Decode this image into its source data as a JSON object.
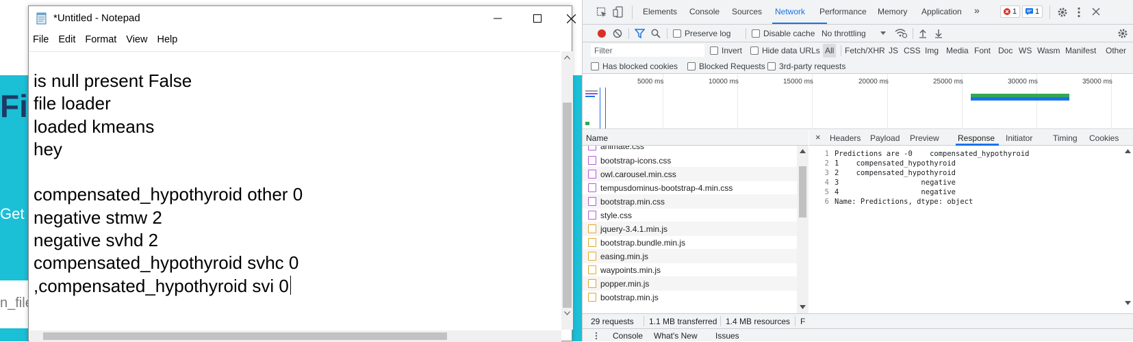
{
  "background_page": {
    "heading": "Fi",
    "button_text": "Get",
    "input_text": "n_file"
  },
  "notepad": {
    "title": "*Untitled - Notepad",
    "menu": [
      "File",
      "Edit",
      "Format",
      "View",
      "Help"
    ],
    "lines": [
      "is null present False",
      "file loader",
      "loaded kmeans",
      "hey",
      "",
      "compensated_hypothyroid other 0",
      "negative stmw 2",
      "negative svhd 2",
      "compensated_hypothyroid svhc 0",
      ",compensated_hypothyroid svi 0"
    ]
  },
  "devtools": {
    "tabs": [
      "Elements",
      "Console",
      "Sources",
      "Network",
      "Performance",
      "Memory",
      "Application"
    ],
    "active_tab": "Network",
    "more_tabs": "»",
    "error_count": "1",
    "message_count": "1",
    "toolbar": {
      "preserve_log": "Preserve log",
      "disable_cache": "Disable cache",
      "throttling": "No throttling"
    },
    "filter": {
      "placeholder": "Filter",
      "invert": "Invert",
      "hide_data_urls": "Hide data URLs",
      "types": [
        "All",
        "Fetch/XHR",
        "JS",
        "CSS",
        "Img",
        "Media",
        "Font",
        "Doc",
        "WS",
        "Wasm",
        "Manifest",
        "Other"
      ],
      "active_type": "All"
    },
    "checks": [
      "Has blocked cookies",
      "Blocked Requests",
      "3rd-party requests"
    ],
    "timeline_labels": [
      "5000 ms",
      "10000 ms",
      "15000 ms",
      "20000 ms",
      "25000 ms",
      "30000 ms",
      "35000 ms"
    ],
    "list": {
      "header": "Name",
      "partial_first": "animate.css",
      "requests": [
        {
          "name": "bootstrap-icons.css",
          "type": "css"
        },
        {
          "name": "owl.carousel.min.css",
          "type": "css"
        },
        {
          "name": "tempusdominus-bootstrap-4.min.css",
          "type": "css"
        },
        {
          "name": "bootstrap.min.css",
          "type": "css"
        },
        {
          "name": "style.css",
          "type": "css"
        },
        {
          "name": "jquery-3.4.1.min.js",
          "type": "js"
        },
        {
          "name": "bootstrap.bundle.min.js",
          "type": "js"
        },
        {
          "name": "easing.min.js",
          "type": "js"
        },
        {
          "name": "waypoints.min.js",
          "type": "js"
        },
        {
          "name": "popper.min.js",
          "type": "js"
        },
        {
          "name": "bootstrap.min.js",
          "type": "js"
        }
      ]
    },
    "detail": {
      "close": "×",
      "tabs": [
        "Headers",
        "Payload",
        "Preview",
        "Response",
        "Initiator",
        "Timing",
        "Cookies"
      ],
      "active_tab": "Response",
      "response_lines": [
        "Predictions are -0    compensated_hypothyroid",
        "1    compensated_hypothyroid",
        "2    compensated_hypothyroid",
        "3                   negative",
        "4                   negative",
        "Name: Predictions, dtype: object"
      ]
    },
    "status": {
      "requests": "29 requests",
      "transferred": "1.1 MB transferred",
      "resources": "1.4 MB resources",
      "extra": "F"
    },
    "drawer_tabs": [
      "Console",
      "What's New",
      "Issues"
    ]
  }
}
